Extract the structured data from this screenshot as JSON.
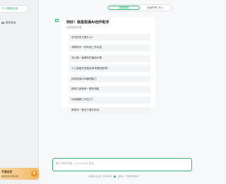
{
  "sidebar": {
    "new_chat_label": "创建新会话",
    "history": [
      {
        "label": "新的会话"
      }
    ],
    "vip": {
      "title": "开通会员",
      "subtitle": "解锁更多高级功能"
    }
  },
  "model_switch": {
    "tabs": [
      {
        "label": "极速模型",
        "active": true
      },
      {
        "label": "深度思考 (R1)",
        "active": false
      }
    ]
  },
  "chat": {
    "greeting_title": "你好！我是悦通AI创作助手",
    "greeting_subtitle": "试试这样问我",
    "suggestions": [
      "读书的意义是什么？",
      "请帮我写一份年度工作总结",
      "怎么做一道美味的番茄炒蛋",
      "人工智能的发展会带来哪些影响？",
      "如何提高时间管理能力",
      "推荐几部值得一看的电影",
      "如何缓解工作压力？",
      "帮我写一首关于春天的诗"
    ]
  },
  "input": {
    "placeholder": "输入你的问题，Ctrl+Enter发送"
  },
  "footer": {
    "left_text": "内容由AI生成，仅供参考",
    "right_text": "悦通AI · 智能创作助手"
  },
  "colors": {
    "accent": "#3bb07a",
    "vip_gradient_start": "#f7d8a8",
    "vip_gradient_end": "#f3b866"
  }
}
